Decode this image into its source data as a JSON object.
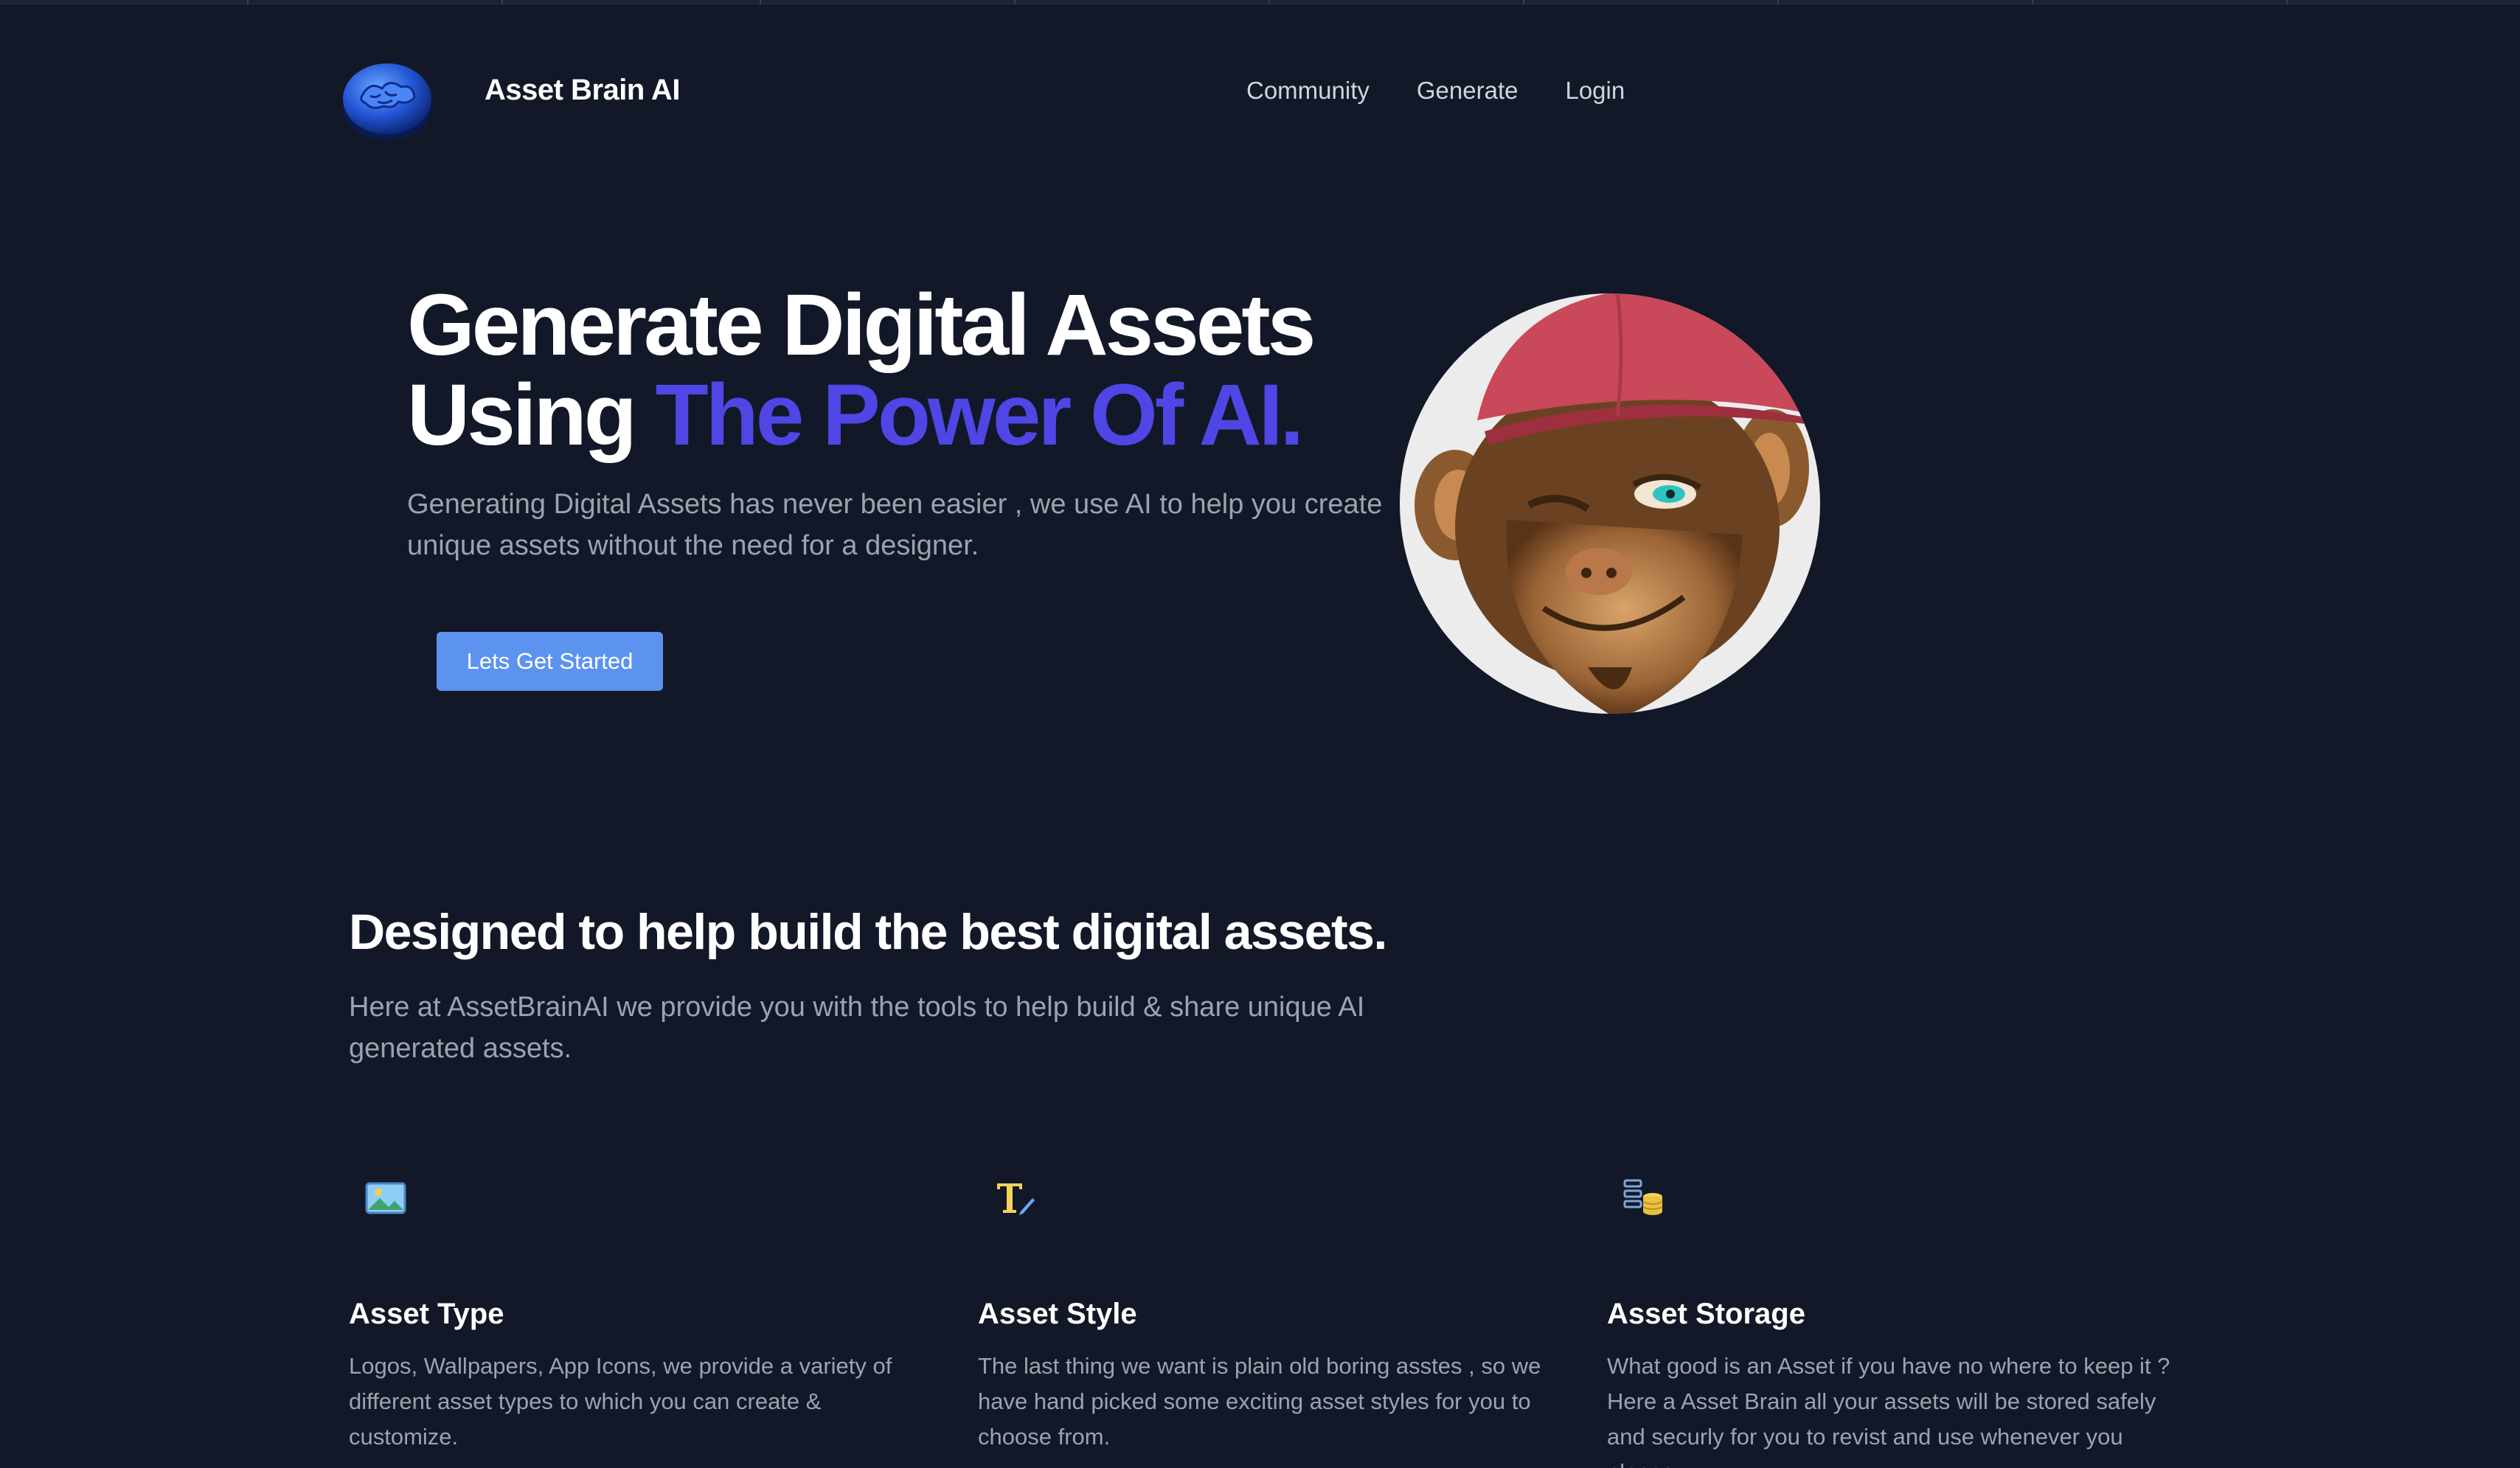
{
  "header": {
    "brand": "Asset Brain AI",
    "nav": [
      "Community",
      "Generate",
      "Login"
    ]
  },
  "hero": {
    "title_line1": "Generate Digital Assets",
    "title_line2_plain": "Using ",
    "title_line2_accent": "The Power Of AI.",
    "subtitle": "Generating Digital Assets has never been easier , we use AI to help you create unique assets without the need for a designer.",
    "cta_label": "Lets Get Started",
    "accent_color": "#4f46e5",
    "cta_color": "#5b93ee"
  },
  "features": {
    "title": "Designed to help build the best digital assets.",
    "subtitle": "Here at AssetBrainAI we provide you with the tools to help build & share unique AI generated assets.",
    "items": [
      {
        "icon": "image-icon",
        "title": "Asset Type",
        "text": "Logos, Wallpapers, App Icons, we provide a variety of different asset types to which you can create & customize."
      },
      {
        "icon": "text-style-icon",
        "title": "Asset Style",
        "text": "The last thing we want is plain old boring asstes , so we have hand picked some exciting asset styles for you to choose from."
      },
      {
        "icon": "database-icon",
        "title": "Asset Storage",
        "text": "What good is an Asset if you have no where to keep it ? Here a Asset Brain all your assets will be stored safely and securly for you to revist and use whenever you please."
      }
    ]
  },
  "colors": {
    "background": "#121827",
    "muted_text": "#9ca3af"
  }
}
